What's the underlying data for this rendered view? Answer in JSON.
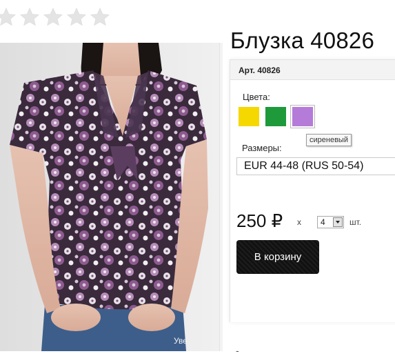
{
  "rating": {
    "stars_total": 5,
    "stars_filled": 0
  },
  "product": {
    "title": "Блузка 40826",
    "sku_label": "Арт. 40826",
    "image_watermark": "Уве"
  },
  "colors": {
    "label": "Цвета:",
    "swatches": [
      {
        "name": "yellow",
        "color": "#f5d800"
      },
      {
        "name": "green",
        "color": "#1e9a3a"
      },
      {
        "name": "lilac",
        "color": "#b47bd8"
      }
    ],
    "hover_tooltip": "сиреневый"
  },
  "sizes": {
    "label": "Размеры:",
    "selected": "EUR 44-48 (RUS 50-54)"
  },
  "price": {
    "value": "250 ₽",
    "times": "x",
    "quantity": "4",
    "unit": "шт."
  },
  "cart": {
    "button_label": "В корзину"
  },
  "footer": {
    "dot": "-"
  }
}
